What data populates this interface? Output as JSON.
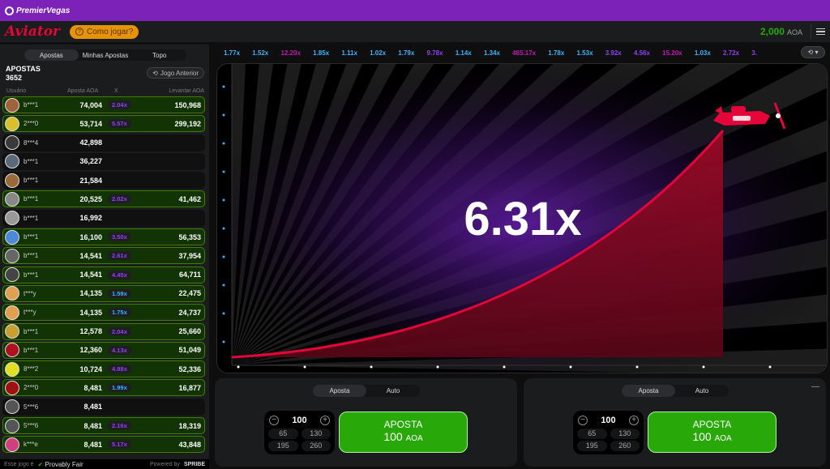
{
  "topbar": {
    "brand": "PremierVegas"
  },
  "header": {
    "logo": "Aviator",
    "how_to": "Como jogar?",
    "balance": "2,000",
    "currency": "AOA"
  },
  "left": {
    "tabs": [
      "Apostas",
      "Minhas Apostas",
      "Topo"
    ],
    "title": "APOSTAS",
    "count": "3652",
    "prev_button": "Jogo Anterior",
    "columns": [
      "Usuário",
      "Aposta AOA",
      "X",
      "Levantar AOA"
    ],
    "rows": [
      {
        "user": "b***1",
        "bet": "74,004",
        "x": "2.04x",
        "cash": "150,968",
        "xc": "#913ef8",
        "win": true,
        "av": "#a0623b"
      },
      {
        "user": "2***0",
        "bet": "53,714",
        "x": "5.57x",
        "cash": "299,192",
        "xc": "#913ef8",
        "win": true,
        "av": "#d9c02a"
      },
      {
        "user": "8***4",
        "bet": "42,898",
        "x": "",
        "cash": "",
        "xc": "",
        "win": false,
        "av": "#3a3a3a"
      },
      {
        "user": "b***1",
        "bet": "36,227",
        "x": "",
        "cash": "",
        "xc": "",
        "win": false,
        "av": "#5a6a7a"
      },
      {
        "user": "b***1",
        "bet": "21,584",
        "x": "",
        "cash": "",
        "xc": "",
        "win": false,
        "av": "#9a6a3a"
      },
      {
        "user": "b***1",
        "bet": "20,525",
        "x": "2.02x",
        "cash": "41,462",
        "xc": "#913ef8",
        "win": true,
        "av": "#888888"
      },
      {
        "user": "b***1",
        "bet": "16,992",
        "x": "",
        "cash": "",
        "xc": "",
        "win": false,
        "av": "#999999"
      },
      {
        "user": "b***1",
        "bet": "16,100",
        "x": "3.50x",
        "cash": "56,353",
        "xc": "#913ef8",
        "win": true,
        "av": "#4a8ad8"
      },
      {
        "user": "b***1",
        "bet": "14,541",
        "x": "2.61x",
        "cash": "37,954",
        "xc": "#913ef8",
        "win": true,
        "av": "#666666"
      },
      {
        "user": "b***1",
        "bet": "14,541",
        "x": "4.45x",
        "cash": "64,711",
        "xc": "#913ef8",
        "win": true,
        "av": "#444444"
      },
      {
        "user": "t***y",
        "bet": "14,135",
        "x": "1.59x",
        "cash": "22,475",
        "xc": "#34b4ff",
        "win": true,
        "av": "#e0a050"
      },
      {
        "user": "t***y",
        "bet": "14,135",
        "x": "1.75x",
        "cash": "24,737",
        "xc": "#34b4ff",
        "win": true,
        "av": "#e0a050"
      },
      {
        "user": "b***1",
        "bet": "12,578",
        "x": "2.04x",
        "cash": "25,660",
        "xc": "#913ef8",
        "win": true,
        "av": "#c8a030"
      },
      {
        "user": "b***1",
        "bet": "12,360",
        "x": "4.13x",
        "cash": "51,049",
        "xc": "#913ef8",
        "win": true,
        "av": "#b01020"
      },
      {
        "user": "8***2",
        "bet": "10,724",
        "x": "4.88x",
        "cash": "52,336",
        "xc": "#913ef8",
        "win": true,
        "av": "#e0e020"
      },
      {
        "user": "2***0",
        "bet": "8,481",
        "x": "1.99x",
        "cash": "16,877",
        "xc": "#34b4ff",
        "win": true,
        "av": "#a01010"
      },
      {
        "user": "5***6",
        "bet": "8,481",
        "x": "",
        "cash": "",
        "xc": "",
        "win": false,
        "av": "#555555"
      },
      {
        "user": "5***6",
        "bet": "8,481",
        "x": "2.16x",
        "cash": "18,319",
        "xc": "#913ef8",
        "win": true,
        "av": "#555555"
      },
      {
        "user": "k***e",
        "bet": "8,481",
        "x": "5.17x",
        "cash": "43,848",
        "xc": "#913ef8",
        "win": true,
        "av": "#d04080"
      }
    ],
    "footer": {
      "game_text": "Esse jogo é",
      "provably_fair": "Provably Fair",
      "powered": "Powered by",
      "spribe": "SPRIBE"
    }
  },
  "payouts": [
    {
      "v": "1.77x",
      "c": "#34b4ff"
    },
    {
      "v": "1.52x",
      "c": "#34b4ff"
    },
    {
      "v": "12.20x",
      "c": "#c017b4"
    },
    {
      "v": "1.85x",
      "c": "#34b4ff"
    },
    {
      "v": "1.11x",
      "c": "#34b4ff"
    },
    {
      "v": "1.02x",
      "c": "#34b4ff"
    },
    {
      "v": "1.79x",
      "c": "#34b4ff"
    },
    {
      "v": "9.78x",
      "c": "#913ef8"
    },
    {
      "v": "1.14x",
      "c": "#34b4ff"
    },
    {
      "v": "1.34x",
      "c": "#34b4ff"
    },
    {
      "v": "485.17x",
      "c": "#c017b4"
    },
    {
      "v": "1.78x",
      "c": "#34b4ff"
    },
    {
      "v": "1.53x",
      "c": "#34b4ff"
    },
    {
      "v": "3.92x",
      "c": "#913ef8"
    },
    {
      "v": "4.56x",
      "c": "#913ef8"
    },
    {
      "v": "15.20x",
      "c": "#c017b4"
    },
    {
      "v": "1.03x",
      "c": "#34b4ff"
    },
    {
      "v": "2.72x",
      "c": "#913ef8"
    },
    {
      "v": "3.",
      "c": "#913ef8"
    }
  ],
  "game": {
    "multiplier": "6.31x",
    "accent": "#e50539"
  },
  "bet_panels": [
    {
      "tabs": [
        "Aposta",
        "Auto"
      ],
      "amount": "100",
      "quick": [
        "65",
        "130",
        "195",
        "260"
      ],
      "btn_label": "APOSTA",
      "btn_amount": "100",
      "btn_cur": "AOA"
    },
    {
      "tabs": [
        "Aposta",
        "Auto"
      ],
      "amount": "100",
      "quick": [
        "65",
        "130",
        "195",
        "260"
      ],
      "btn_label": "APOSTA",
      "btn_amount": "100",
      "btn_cur": "AOA",
      "minus": "—"
    }
  ]
}
